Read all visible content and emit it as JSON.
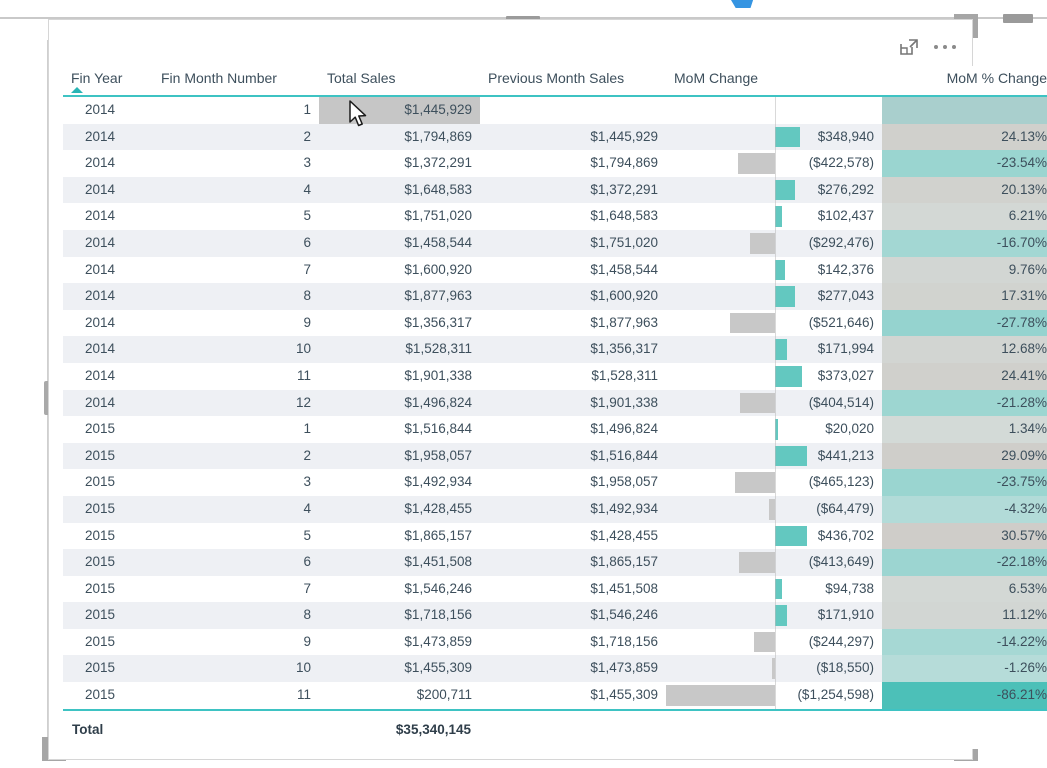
{
  "visual": {
    "actions": {
      "focus_mode_icon": "focus-mode-icon",
      "more_options_icon": "more-options-ellipsis-icon"
    }
  },
  "table": {
    "columns": [
      {
        "key": "fin_year",
        "label": "Fin Year",
        "align": "left",
        "sorted": "asc"
      },
      {
        "key": "fin_month_number",
        "label": "Fin Month Number",
        "align": "right"
      },
      {
        "key": "total_sales",
        "label": "Total Sales",
        "align": "right"
      },
      {
        "key": "previous_month_sales",
        "label": "Previous Month Sales",
        "align": "right"
      },
      {
        "key": "mom_change",
        "label": "MoM Change",
        "align": "right"
      },
      {
        "key": "mom_pct_change",
        "label": "MoM % Change",
        "align": "right"
      }
    ],
    "rows": [
      {
        "fin_year": "2014",
        "fin_month_number": "1",
        "total_sales": "$1,445,929",
        "previous_month_sales": "",
        "mom_change": "",
        "mom_pct_change": "",
        "mom_change_value": null,
        "mom_pct_value": null,
        "selected": true
      },
      {
        "fin_year": "2014",
        "fin_month_number": "2",
        "total_sales": "$1,794,869",
        "previous_month_sales": "$1,445,929",
        "mom_change": "$348,940",
        "mom_pct_change": "24.13%",
        "mom_change_value": 348940,
        "mom_pct_value": 24.13
      },
      {
        "fin_year": "2014",
        "fin_month_number": "3",
        "total_sales": "$1,372,291",
        "previous_month_sales": "$1,794,869",
        "mom_change": "($422,578)",
        "mom_pct_change": "-23.54%",
        "mom_change_value": -422578,
        "mom_pct_value": -23.54
      },
      {
        "fin_year": "2014",
        "fin_month_number": "4",
        "total_sales": "$1,648,583",
        "previous_month_sales": "$1,372,291",
        "mom_change": "$276,292",
        "mom_pct_change": "20.13%",
        "mom_change_value": 276292,
        "mom_pct_value": 20.13
      },
      {
        "fin_year": "2014",
        "fin_month_number": "5",
        "total_sales": "$1,751,020",
        "previous_month_sales": "$1,648,583",
        "mom_change": "$102,437",
        "mom_pct_change": "6.21%",
        "mom_change_value": 102437,
        "mom_pct_value": 6.21
      },
      {
        "fin_year": "2014",
        "fin_month_number": "6",
        "total_sales": "$1,458,544",
        "previous_month_sales": "$1,751,020",
        "mom_change": "($292,476)",
        "mom_pct_change": "-16.70%",
        "mom_change_value": -292476,
        "mom_pct_value": -16.7
      },
      {
        "fin_year": "2014",
        "fin_month_number": "7",
        "total_sales": "$1,600,920",
        "previous_month_sales": "$1,458,544",
        "mom_change": "$142,376",
        "mom_pct_change": "9.76%",
        "mom_change_value": 142376,
        "mom_pct_value": 9.76
      },
      {
        "fin_year": "2014",
        "fin_month_number": "8",
        "total_sales": "$1,877,963",
        "previous_month_sales": "$1,600,920",
        "mom_change": "$277,043",
        "mom_pct_change": "17.31%",
        "mom_change_value": 277043,
        "mom_pct_value": 17.31
      },
      {
        "fin_year": "2014",
        "fin_month_number": "9",
        "total_sales": "$1,356,317",
        "previous_month_sales": "$1,877,963",
        "mom_change": "($521,646)",
        "mom_pct_change": "-27.78%",
        "mom_change_value": -521646,
        "mom_pct_value": -27.78
      },
      {
        "fin_year": "2014",
        "fin_month_number": "10",
        "total_sales": "$1,528,311",
        "previous_month_sales": "$1,356,317",
        "mom_change": "$171,994",
        "mom_pct_change": "12.68%",
        "mom_change_value": 171994,
        "mom_pct_value": 12.68
      },
      {
        "fin_year": "2014",
        "fin_month_number": "11",
        "total_sales": "$1,901,338",
        "previous_month_sales": "$1,528,311",
        "mom_change": "$373,027",
        "mom_pct_change": "24.41%",
        "mom_change_value": 373027,
        "mom_pct_value": 24.41
      },
      {
        "fin_year": "2014",
        "fin_month_number": "12",
        "total_sales": "$1,496,824",
        "previous_month_sales": "$1,901,338",
        "mom_change": "($404,514)",
        "mom_pct_change": "-21.28%",
        "mom_change_value": -404514,
        "mom_pct_value": -21.28
      },
      {
        "fin_year": "2015",
        "fin_month_number": "1",
        "total_sales": "$1,516,844",
        "previous_month_sales": "$1,496,824",
        "mom_change": "$20,020",
        "mom_pct_change": "1.34%",
        "mom_change_value": 20020,
        "mom_pct_value": 1.34
      },
      {
        "fin_year": "2015",
        "fin_month_number": "2",
        "total_sales": "$1,958,057",
        "previous_month_sales": "$1,516,844",
        "mom_change": "$441,213",
        "mom_pct_change": "29.09%",
        "mom_change_value": 441213,
        "mom_pct_value": 29.09
      },
      {
        "fin_year": "2015",
        "fin_month_number": "3",
        "total_sales": "$1,492,934",
        "previous_month_sales": "$1,958,057",
        "mom_change": "($465,123)",
        "mom_pct_change": "-23.75%",
        "mom_change_value": -465123,
        "mom_pct_value": -23.75
      },
      {
        "fin_year": "2015",
        "fin_month_number": "4",
        "total_sales": "$1,428,455",
        "previous_month_sales": "$1,492,934",
        "mom_change": "($64,479)",
        "mom_pct_change": "-4.32%",
        "mom_change_value": -64479,
        "mom_pct_value": -4.32
      },
      {
        "fin_year": "2015",
        "fin_month_number": "5",
        "total_sales": "$1,865,157",
        "previous_month_sales": "$1,428,455",
        "mom_change": "$436,702",
        "mom_pct_change": "30.57%",
        "mom_change_value": 436702,
        "mom_pct_value": 30.57
      },
      {
        "fin_year": "2015",
        "fin_month_number": "6",
        "total_sales": "$1,451,508",
        "previous_month_sales": "$1,865,157",
        "mom_change": "($413,649)",
        "mom_pct_change": "-22.18%",
        "mom_change_value": -413649,
        "mom_pct_value": -22.18
      },
      {
        "fin_year": "2015",
        "fin_month_number": "7",
        "total_sales": "$1,546,246",
        "previous_month_sales": "$1,451,508",
        "mom_change": "$94,738",
        "mom_pct_change": "6.53%",
        "mom_change_value": 94738,
        "mom_pct_value": 6.53
      },
      {
        "fin_year": "2015",
        "fin_month_number": "8",
        "total_sales": "$1,718,156",
        "previous_month_sales": "$1,546,246",
        "mom_change": "$171,910",
        "mom_pct_change": "11.12%",
        "mom_change_value": 171910,
        "mom_pct_value": 11.12
      },
      {
        "fin_year": "2015",
        "fin_month_number": "9",
        "total_sales": "$1,473,859",
        "previous_month_sales": "$1,718,156",
        "mom_change": "($244,297)",
        "mom_pct_change": "-14.22%",
        "mom_change_value": -244297,
        "mom_pct_value": -14.22
      },
      {
        "fin_year": "2015",
        "fin_month_number": "10",
        "total_sales": "$1,455,309",
        "previous_month_sales": "$1,473,859",
        "mom_change": "($18,550)",
        "mom_pct_change": "-1.26%",
        "mom_change_value": -18550,
        "mom_pct_value": -1.26
      },
      {
        "fin_year": "2015",
        "fin_month_number": "11",
        "total_sales": "$200,711",
        "previous_month_sales": "$1,455,309",
        "mom_change": "($1,254,598)",
        "mom_pct_change": "-86.21%",
        "mom_change_value": -1254598,
        "mom_pct_value": -86.21
      }
    ],
    "total_row": {
      "label": "Total",
      "total_sales": "$35,340,145"
    }
  },
  "chart_data": {
    "type": "table",
    "title": "Total Sales Month-over-Month change by Fin Year and Fin Month Number",
    "columns": [
      "Fin Year",
      "Fin Month Number",
      "Total Sales",
      "Previous Month Sales",
      "MoM Change",
      "MoM % Change"
    ],
    "conditional_formatting": {
      "mom_change": {
        "style": "data-bars",
        "positive_color": "#63c8c0",
        "negative_color": "#c8c8c8",
        "axis": "center-zero",
        "max_abs": 1254598
      },
      "mom_pct_change": {
        "style": "background-color-scale",
        "negative_color": "#4cc0b8",
        "positive_color": "#cfcdc9",
        "min": -86.21,
        "max": 30.57
      }
    },
    "series": [
      {
        "name": "Total Sales",
        "values": [
          1445929,
          1794869,
          1372291,
          1648583,
          1751020,
          1458544,
          1600920,
          1877963,
          1356317,
          1528311,
          1901338,
          1496824,
          1516844,
          1958057,
          1492934,
          1428455,
          1865157,
          1451508,
          1546246,
          1718156,
          1473859,
          1455309,
          200711
        ]
      },
      {
        "name": "Previous Month Sales",
        "values": [
          null,
          1445929,
          1794869,
          1372291,
          1648583,
          1751020,
          1458544,
          1600920,
          1877963,
          1356317,
          1528311,
          1901338,
          1496824,
          1516844,
          1958057,
          1492934,
          1428455,
          1865157,
          1451508,
          1546246,
          1718156,
          1473859,
          1455309
        ]
      },
      {
        "name": "MoM Change",
        "values": [
          null,
          348940,
          -422578,
          276292,
          102437,
          -292476,
          142376,
          277043,
          -521646,
          171994,
          373027,
          -404514,
          20020,
          441213,
          -465123,
          -64479,
          436702,
          -413649,
          94738,
          171910,
          -244297,
          -18550,
          -1254598
        ]
      },
      {
        "name": "MoM % Change",
        "values": [
          null,
          24.13,
          -23.54,
          20.13,
          6.21,
          -16.7,
          9.76,
          17.31,
          -27.78,
          12.68,
          24.41,
          -21.28,
          1.34,
          29.09,
          -23.75,
          -4.32,
          30.57,
          -22.18,
          6.53,
          11.12,
          -14.22,
          -1.26,
          -86.21
        ]
      }
    ],
    "categories": [
      "2014-1",
      "2014-2",
      "2014-3",
      "2014-4",
      "2014-5",
      "2014-6",
      "2014-7",
      "2014-8",
      "2014-9",
      "2014-10",
      "2014-11",
      "2014-12",
      "2015-1",
      "2015-2",
      "2015-3",
      "2015-4",
      "2015-5",
      "2015-6",
      "2015-7",
      "2015-8",
      "2015-9",
      "2015-10",
      "2015-11"
    ],
    "total": 35340145
  },
  "theme": {
    "accent_teal": "#3ec3c3",
    "bar_positive": "#63c8c0",
    "bar_negative": "#c8c8c8",
    "text": "#3d4f5c",
    "stripe": "#eef0f4"
  }
}
